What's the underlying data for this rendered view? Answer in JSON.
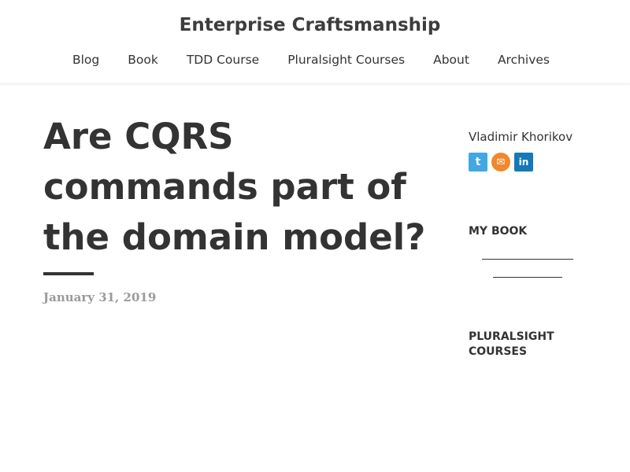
{
  "site": {
    "title": "Enterprise Craftsmanship"
  },
  "nav": {
    "items": [
      "Blog",
      "Book",
      "TDD Course",
      "Pluralsight Courses",
      "About",
      "Archives"
    ]
  },
  "post": {
    "title": "Are CQRS commands part of the domain model?",
    "date": "January 31, 2019"
  },
  "sidebar": {
    "author": "Vladimir Khorikov",
    "social_icons": [
      "twitter-icon",
      "email-icon",
      "linkedin-icon"
    ],
    "my_book_heading": "MY BOOK",
    "courses_heading": "PLURALSIGHT COURSES"
  },
  "colors": {
    "text": "#333333",
    "date": "#9a9a9a",
    "twitter": "#41a8e3",
    "email": "#f0882d",
    "linkedin": "#1479b6"
  }
}
